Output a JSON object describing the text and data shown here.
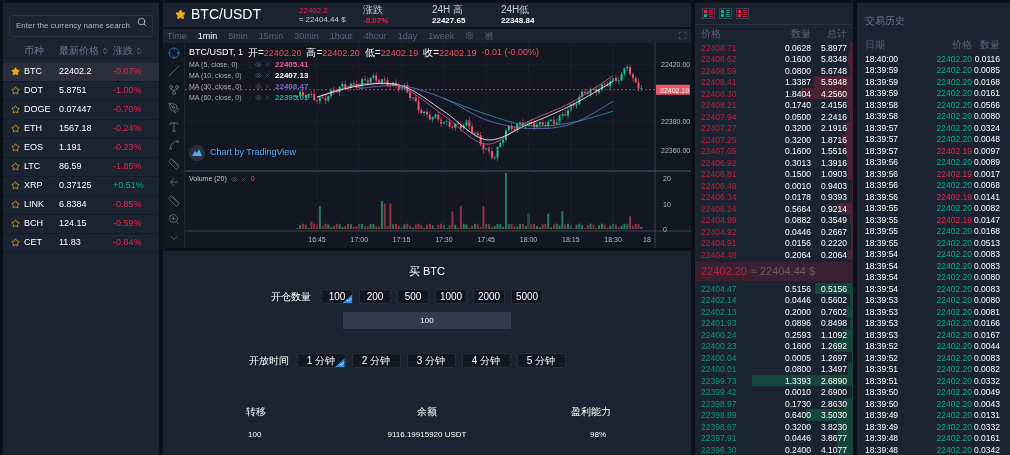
{
  "markets": {
    "search": {
      "placeholder": "Enter the currency name search"
    },
    "columns": [
      {
        "label": "币种",
        "sortable": false
      },
      {
        "label": "最新价格",
        "sortable": true
      },
      {
        "label": "涨跌",
        "sortable": true
      }
    ],
    "rows": [
      {
        "symbol": "BTC",
        "price": "22402.2",
        "change": "-0.07%",
        "negative": true,
        "favorite": true,
        "selected": true
      },
      {
        "symbol": "DOT",
        "price": "5.8751",
        "change": "-1.00%",
        "negative": true,
        "favorite": false,
        "selected": false
      },
      {
        "symbol": "DOGE",
        "price": "0.07447",
        "change": "-0.70%",
        "negative": true,
        "favorite": false,
        "selected": false
      },
      {
        "symbol": "ETH",
        "price": "1567.18",
        "change": "-0.24%",
        "negative": true,
        "favorite": false,
        "selected": false
      },
      {
        "symbol": "EOS",
        "price": "1.191",
        "change": "-0.23%",
        "negative": true,
        "favorite": false,
        "selected": false
      },
      {
        "symbol": "LTC",
        "price": "86.59",
        "change": "-1.85%",
        "negative": true,
        "favorite": false,
        "selected": false
      },
      {
        "symbol": "XRP",
        "price": "0.37125",
        "change": "+0.51%",
        "negative": false,
        "favorite": false,
        "selected": false
      },
      {
        "symbol": "LINK",
        "price": "6.8384",
        "change": "-0.85%",
        "negative": true,
        "favorite": false,
        "selected": false
      },
      {
        "symbol": "BCH",
        "price": "124.15",
        "change": "-0.59%",
        "negative": true,
        "favorite": false,
        "selected": false
      },
      {
        "symbol": "CET",
        "price": "11.83",
        "change": "-0.84%",
        "negative": true,
        "favorite": false,
        "selected": false
      }
    ]
  },
  "ticker": {
    "symbol": "BTC/USDT",
    "favorite": true,
    "price": "22402.2",
    "negative": true,
    "approx": "≈ 22404.44 $",
    "stats": [
      {
        "label": "涨跌",
        "value": "-0.07%",
        "negative": true
      },
      {
        "label": "24H 高",
        "value": "22427.65",
        "negative": false
      },
      {
        "label": "24H低",
        "value": "22348.84",
        "negative": false
      }
    ]
  },
  "timeframes": [
    {
      "label": "Time",
      "selected": false
    },
    {
      "label": "1min",
      "selected": true
    },
    {
      "label": "5min",
      "selected": false
    },
    {
      "label": "15min",
      "selected": false
    },
    {
      "label": "30min",
      "selected": false
    },
    {
      "label": "1hour",
      "selected": false
    },
    {
      "label": "4hour",
      "selected": false
    },
    {
      "label": "1day",
      "selected": false
    },
    {
      "label": "1week",
      "selected": false
    }
  ],
  "chart": {
    "symbol": "BTC/USDT, 1",
    "ohlc": [
      {
        "label": "开=",
        "value": "22402.20"
      },
      {
        "label": "高=",
        "value": "22402.20"
      },
      {
        "label": "低=",
        "value": "22402.19"
      },
      {
        "label": "收=",
        "value": "22402.19"
      }
    ],
    "change": "-0.01 (-0.00%)",
    "studies": [
      {
        "value": "22405.41"
      },
      {
        "value": "22407.13"
      },
      {
        "value": "22408.47"
      },
      {
        "value": "22395.01"
      }
    ],
    "attribution": "Chart by TradingView",
    "volume": {
      "name": "Volume (20)",
      "value": "0"
    },
    "current_price": "22402.19",
    "volume_ticks": [
      "20",
      "10",
      "0"
    ],
    "time_tick_cut": "18",
    "chart_data": {
      "type": "line",
      "grid": true,
      "ylim": [
        22291,
        22435
      ],
      "categories": [
        "16:45",
        "17:00",
        "17:15",
        "17:30",
        "17:45",
        "18:00",
        "18:15",
        "18:30"
      ],
      "yticks": [
        {
          "value": 22420,
          "label": "22420.00"
        },
        {
          "value": 22380,
          "label": "22380.00"
        },
        {
          "value": 22360,
          "label": "22360.00"
        }
      ],
      "series": [
        {
          "name": "MA (5, close, 0)",
          "color": "#e0609c",
          "values": [
            22397,
            22406,
            22404,
            22384,
            22364,
            22380,
            22393,
            22412
          ]
        },
        {
          "name": "MA (10, close, 0)",
          "color": "#ffffff",
          "values": [
            22397,
            22405,
            22405,
            22387,
            22367,
            22378,
            22391,
            22408
          ]
        },
        {
          "name": "MA (30, close, 0)",
          "color": "#7a6fd0",
          "values": [
            null,
            22403,
            22405,
            22396,
            22381,
            22375,
            22378,
            22394
          ]
        },
        {
          "name": "MA (60, close, 0)",
          "color": "#2aa39a",
          "values": [
            null,
            null,
            null,
            22396,
            22385,
            22377,
            22379,
            22387
          ]
        }
      ]
    }
  },
  "order_form": {
    "title": "买 BTC",
    "amount_label": "开仓数量",
    "amounts": [
      {
        "label": "100",
        "selected": true
      },
      {
        "label": "200",
        "selected": false
      },
      {
        "label": "500",
        "selected": false
      },
      {
        "label": "1000",
        "selected": false
      },
      {
        "label": "2000",
        "selected": false
      },
      {
        "label": "5000",
        "selected": false
      }
    ],
    "amount_value": "100",
    "time_label": "开放时间",
    "durations": [
      {
        "label": "1 分钟",
        "selected": true
      },
      {
        "label": "2 分钟",
        "selected": false
      },
      {
        "label": "3 分钟",
        "selected": false
      },
      {
        "label": "4 分钟",
        "selected": false
      },
      {
        "label": "5 分钟",
        "selected": false
      }
    ],
    "summary": [
      {
        "label": "转移",
        "value": "100"
      },
      {
        "label": "余额",
        "value": "9116.19915920 USDT"
      },
      {
        "label": "盈利能力",
        "value": "98%"
      }
    ]
  },
  "order_book": {
    "views": [
      {
        "kind": "both"
      },
      {
        "kind": "bids"
      },
      {
        "kind": "asks"
      }
    ],
    "columns": [
      "价格",
      "数量",
      "总计"
    ],
    "asks": [
      {
        "price": "22408.71",
        "amount": "0.0628",
        "total": "5.8977",
        "level": 0.02
      },
      {
        "price": "22408.62",
        "amount": "0.1600",
        "total": "5.8348",
        "level": 0.03
      },
      {
        "price": "22408.59",
        "amount": "0.0800",
        "total": "5.6748",
        "level": 0.02
      },
      {
        "price": "22408.41",
        "amount": "1.3387",
        "total": "5.5948",
        "level": 0.25
      },
      {
        "price": "22408.30",
        "amount": "1.8404",
        "total": "4.2560",
        "level": 0.33
      },
      {
        "price": "22408.21",
        "amount": "0.1740",
        "total": "2.4156",
        "level": 0.03
      },
      {
        "price": "22407.94",
        "amount": "0.0500",
        "total": "2.2416",
        "level": 0.02
      },
      {
        "price": "22407.27",
        "amount": "0.3200",
        "total": "2.1916",
        "level": 0.05
      },
      {
        "price": "22407.25",
        "amount": "0.3200",
        "total": "1.8716",
        "level": 0.07
      },
      {
        "price": "22407.05",
        "amount": "0.1600",
        "total": "1.5516",
        "level": 0.05
      },
      {
        "price": "22406.92",
        "amount": "0.3013",
        "total": "1.3916",
        "level": 0.04
      },
      {
        "price": "22406.81",
        "amount": "0.1500",
        "total": "1.0903",
        "level": 0.03
      },
      {
        "price": "22406.48",
        "amount": "0.0010",
        "total": "0.9403",
        "level": 0
      },
      {
        "price": "22406.34",
        "amount": "0.0178",
        "total": "0.9393",
        "level": 0
      },
      {
        "price": "22406.24",
        "amount": "0.5664",
        "total": "0.9214",
        "level": 0.1
      },
      {
        "price": "22404.99",
        "amount": "0.0882",
        "total": "0.3549",
        "level": 0.02
      },
      {
        "price": "22404.92",
        "amount": "0.0446",
        "total": "0.2667",
        "level": 0.01
      },
      {
        "price": "22404.91",
        "amount": "0.0156",
        "total": "0.2220",
        "level": 0.01
      },
      {
        "price": "22404.48",
        "amount": "0.2064",
        "total": "0.2064",
        "level": 0.04
      }
    ],
    "last_price": "22402.20",
    "last_approx": "≈ 22404.44 $",
    "bids": [
      {
        "price": "22404.47",
        "amount": "0.5156",
        "total": "0.5156",
        "level": 0.24
      },
      {
        "price": "22402.14",
        "amount": "0.0446",
        "total": "0.5602",
        "level": 0.02
      },
      {
        "price": "22402.13",
        "amount": "0.2000",
        "total": "0.7602",
        "level": 0.04
      },
      {
        "price": "22401.93",
        "amount": "0.0896",
        "total": "0.8498",
        "level": 0.02
      },
      {
        "price": "22400.24",
        "amount": "0.2593",
        "total": "1.1092",
        "level": 0.07
      },
      {
        "price": "22400.23",
        "amount": "0.1600",
        "total": "1.2692",
        "level": 0.12
      },
      {
        "price": "22400.04",
        "amount": "0.0005",
        "total": "1.2697",
        "level": 0
      },
      {
        "price": "22400.01",
        "amount": "0.0800",
        "total": "1.3497",
        "level": 0.03
      },
      {
        "price": "22399.73",
        "amount": "1.3393",
        "total": "2.6890",
        "level": 0.64
      },
      {
        "price": "22399.42",
        "amount": "0.0010",
        "total": "2.6900",
        "level": 0
      },
      {
        "price": "22398.97",
        "amount": "0.1730",
        "total": "2.8630",
        "level": 0.06
      },
      {
        "price": "22398.89",
        "amount": "0.6400",
        "total": "3.5030",
        "level": 0.3
      },
      {
        "price": "22398.67",
        "amount": "0.3200",
        "total": "3.8230",
        "level": 0.1
      },
      {
        "price": "22397.91",
        "amount": "0.0446",
        "total": "3.8677",
        "level": 0.1
      },
      {
        "price": "22396.30",
        "amount": "0.2400",
        "total": "4.1077",
        "level": 0.1
      }
    ]
  },
  "trades": {
    "title": "交易历史",
    "columns": [
      "日期",
      "价格",
      "数量"
    ],
    "rows": [
      {
        "time": "18:40:00",
        "price": "22402.20",
        "amount": "0.0116",
        "sell": false
      },
      {
        "time": "18:39:59",
        "price": "22402.20",
        "amount": "0.0085",
        "sell": false
      },
      {
        "time": "18:39:59",
        "price": "22402.20",
        "amount": "0.0168",
        "sell": false
      },
      {
        "time": "18:39:59",
        "price": "22402.20",
        "amount": "0.0161",
        "sell": false
      },
      {
        "time": "18:39:58",
        "price": "22402.20",
        "amount": "0.0566",
        "sell": false
      },
      {
        "time": "18:39:58",
        "price": "22402.20",
        "amount": "0.0080",
        "sell": false
      },
      {
        "time": "18:39:57",
        "price": "22402.20",
        "amount": "0.0324",
        "sell": false
      },
      {
        "time": "18:39:57",
        "price": "22402.20",
        "amount": "0.0048",
        "sell": false
      },
      {
        "time": "18:39:57",
        "price": "22402.19",
        "amount": "0.0097",
        "sell": true
      },
      {
        "time": "18:39:56",
        "price": "22402.20",
        "amount": "0.0089",
        "sell": false
      },
      {
        "time": "18:39:56",
        "price": "22402.19",
        "amount": "0.0017",
        "sell": true
      },
      {
        "time": "18:39:56",
        "price": "22402.20",
        "amount": "0.0068",
        "sell": false
      },
      {
        "time": "18:39:56",
        "price": "22402.19",
        "amount": "0.0141",
        "sell": true
      },
      {
        "time": "18:39:55",
        "price": "22402.20",
        "amount": "0.0082",
        "sell": false
      },
      {
        "time": "18:39:55",
        "price": "22402.19",
        "amount": "0.0147",
        "sell": true
      },
      {
        "time": "18:39:55",
        "price": "22402.20",
        "amount": "0.0168",
        "sell": false
      },
      {
        "time": "18:39:55",
        "price": "22402.20",
        "amount": "0.0513",
        "sell": false
      },
      {
        "time": "18:39:54",
        "price": "22402.20",
        "amount": "0.0083",
        "sell": false
      },
      {
        "time": "18:39:54",
        "price": "22402.20",
        "amount": "0.0083",
        "sell": false
      },
      {
        "time": "18:39:54",
        "price": "22402.20",
        "amount": "0.0080",
        "sell": false
      },
      {
        "time": "18:39:54",
        "price": "22402.20",
        "amount": "0.0083",
        "sell": false
      },
      {
        "time": "18:39:53",
        "price": "22402.20",
        "amount": "0.0080",
        "sell": false
      },
      {
        "time": "18:39:53",
        "price": "22402.20",
        "amount": "0.0081",
        "sell": false
      },
      {
        "time": "18:39:53",
        "price": "22402.20",
        "amount": "0.0166",
        "sell": false
      },
      {
        "time": "18:39:53",
        "price": "22402.20",
        "amount": "0.0167",
        "sell": false
      },
      {
        "time": "18:39:52",
        "price": "22402.20",
        "amount": "0.0044",
        "sell": false
      },
      {
        "time": "18:39:52",
        "price": "22402.20",
        "amount": "0.0083",
        "sell": false
      },
      {
        "time": "18:39:51",
        "price": "22402.20",
        "amount": "0.0082",
        "sell": false
      },
      {
        "time": "18:39:51",
        "price": "22402.20",
        "amount": "0.0332",
        "sell": false
      },
      {
        "time": "18:39:50",
        "price": "22402.20",
        "amount": "0.0049",
        "sell": false
      },
      {
        "time": "18:39:50",
        "price": "22402.20",
        "amount": "0.0043",
        "sell": false
      },
      {
        "time": "18:39:49",
        "price": "22402.20",
        "amount": "0.0131",
        "sell": false
      },
      {
        "time": "18:39:49",
        "price": "22402.20",
        "amount": "0.0332",
        "sell": false
      },
      {
        "time": "18:39:48",
        "price": "22402.20",
        "amount": "0.0161",
        "sell": false
      },
      {
        "time": "18:39:48",
        "price": "22402.20",
        "amount": "0.0342",
        "sell": false
      }
    ]
  }
}
